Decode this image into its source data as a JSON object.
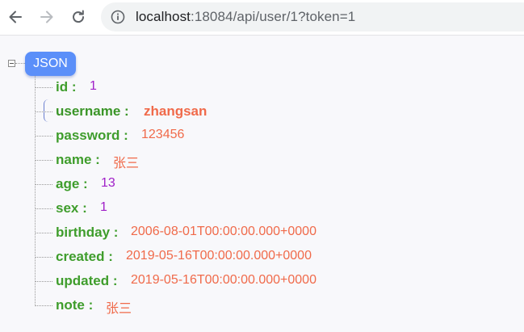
{
  "browser": {
    "url_host": "localhost",
    "url_rest": ":18084/api/user/1?token=1"
  },
  "viewer": {
    "root_label": "JSON",
    "fields": [
      {
        "key": "id :",
        "value": "1",
        "type": "number"
      },
      {
        "key": "username :",
        "value": "zhangsan",
        "type": "string"
      },
      {
        "key": "password :",
        "value": "123456",
        "type": "string"
      },
      {
        "key": "name :",
        "value": "张三",
        "type": "string"
      },
      {
        "key": "age :",
        "value": "13",
        "type": "number"
      },
      {
        "key": "sex :",
        "value": "1",
        "type": "number"
      },
      {
        "key": "birthday :",
        "value": "2006-08-01T00:00:00.000+0000",
        "type": "string"
      },
      {
        "key": "created :",
        "value": "2019-05-16T00:00:00.000+0000",
        "type": "string"
      },
      {
        "key": "updated :",
        "value": "2019-05-16T00:00:00.000+0000",
        "type": "string"
      },
      {
        "key": "note :",
        "value": "张三",
        "type": "string"
      }
    ]
  },
  "colors": {
    "key": "#3f9d2c",
    "number": "#a020c8",
    "string": "#f06a4a",
    "badge": "#5b8ff9"
  },
  "icons": {
    "back": "arrow-left-icon",
    "forward": "arrow-right-icon",
    "reload": "reload-icon",
    "site_info": "info-icon",
    "collapse": "minus-box-icon"
  }
}
